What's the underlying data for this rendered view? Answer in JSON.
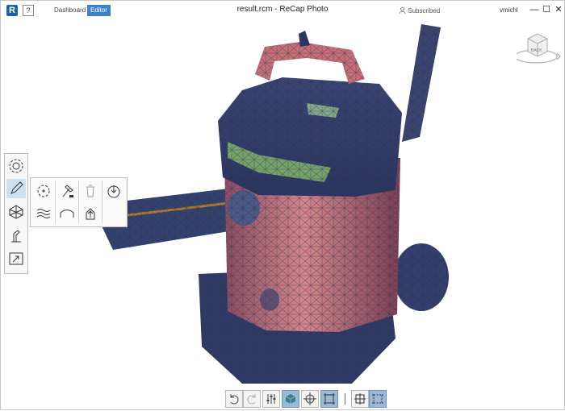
{
  "app": {
    "logo": "R",
    "help_label": "?",
    "title": "result.rcm - ReCap Photo",
    "subscribed_label": "Subscribed",
    "user_name": "vmichl"
  },
  "tabs": [
    {
      "label": "Dashboard",
      "selected": false
    },
    {
      "label": "Editor",
      "selected": true
    }
  ],
  "viewcube": {
    "face_label": "BACK"
  },
  "window_controls": {
    "minimize": "—",
    "maximize": "☐",
    "close": "✕"
  },
  "icons": {
    "left_toolbar": [
      "gear-icon",
      "pencil-icon",
      "mesh-icon",
      "measure-icon",
      "export-icon"
    ],
    "flyout": [
      "heal-gear-icon",
      "hammer-icon",
      "trash-icon",
      "download-icon",
      "smooth-icon",
      "bridge-icon",
      "extrude-icon"
    ],
    "bottom_toolbar": [
      "undo-icon",
      "redo-icon",
      "settings-sliders-icon",
      "solid-view-icon",
      "orbit-icon",
      "frame-icon",
      "select-box-icon",
      "select-crossing-icon"
    ]
  },
  "colors": {
    "accent": "#3f83c7",
    "mesh_red": "#c96a6f",
    "mesh_navy": "#2d3c6a",
    "mesh_green": "#7fae6a",
    "active_button": "#9cb8d8"
  }
}
